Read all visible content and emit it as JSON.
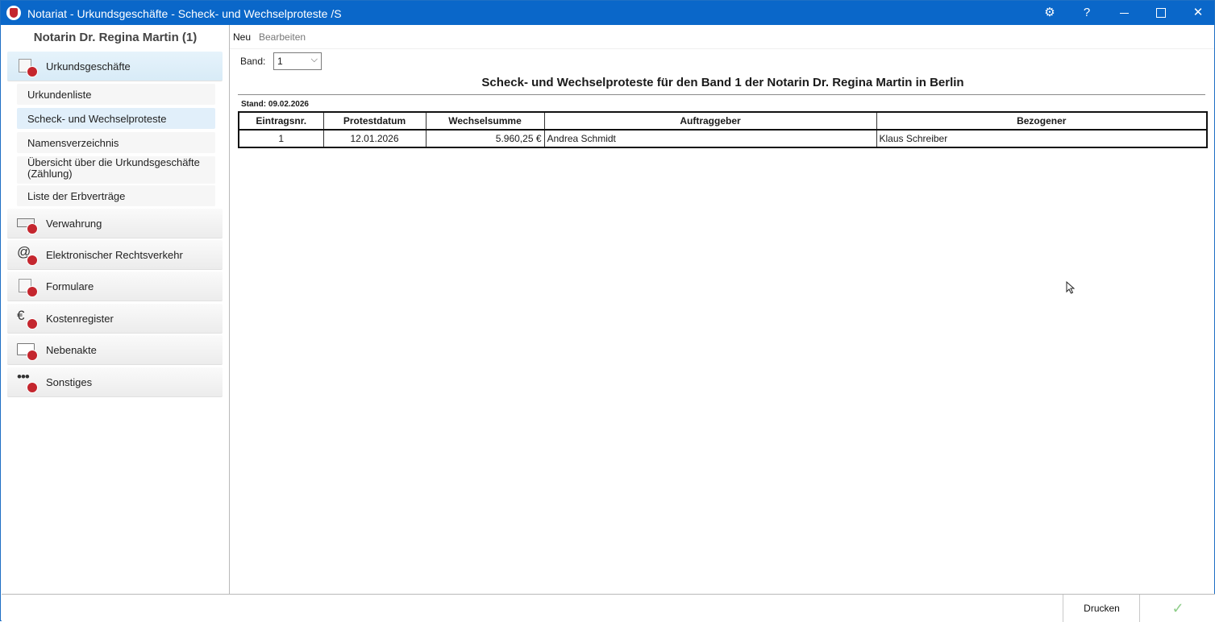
{
  "window": {
    "title": "Notariat - Urkundsgeschäfte - Scheck- und Wechselproteste /S",
    "controls": {
      "gear": "⚙",
      "help": "?",
      "close": "✕"
    }
  },
  "sidebar": {
    "header": "Notarin Dr. Regina Martin (1)",
    "categories": [
      {
        "label": "Urkundsgeschäfte",
        "icon": "document-seal-icon",
        "active": true
      },
      {
        "label": "Verwahrung",
        "icon": "card-seal-icon"
      },
      {
        "label": "Elektronischer Rechtsverkehr",
        "icon": "at-seal-icon"
      },
      {
        "label": "Formulare",
        "icon": "document-seal-icon"
      },
      {
        "label": "Kostenregister",
        "icon": "euro-seal-icon"
      },
      {
        "label": "Nebenakte",
        "icon": "folder-seal-icon"
      },
      {
        "label": "Sonstiges",
        "icon": "dots-seal-icon"
      }
    ],
    "subitems": [
      {
        "label": "Urkundenliste"
      },
      {
        "label": "Scheck- und Wechselproteste",
        "active": true
      },
      {
        "label": "Namensverzeichnis"
      },
      {
        "label": "Übersicht über die Urkundsgeschäfte (Zählung)"
      },
      {
        "label": "Liste der Erbverträge"
      }
    ]
  },
  "menu": {
    "new": "Neu",
    "edit": "Bearbeiten"
  },
  "band": {
    "label": "Band:",
    "value": "1"
  },
  "report": {
    "title": "Scheck- und Wechselproteste für den Band 1 der Notarin Dr. Regina Martin in Berlin",
    "stand": "Stand: 09.02.2026",
    "columns": [
      "Eintragsnr.",
      "Protestdatum",
      "Wechselsumme",
      "Auftraggeber",
      "Bezogener"
    ],
    "rows": [
      [
        "1",
        "12.01.2026",
        "5.960,25 €",
        "Andrea Schmidt",
        "Klaus Schreiber"
      ]
    ]
  },
  "footer": {
    "print": "Drucken",
    "ok": "✓"
  },
  "colors": {
    "titlebar": "#0a67c9",
    "active_nav": "#e1effa",
    "seal": "#c4262e",
    "ok_check": "#8fce8a"
  }
}
